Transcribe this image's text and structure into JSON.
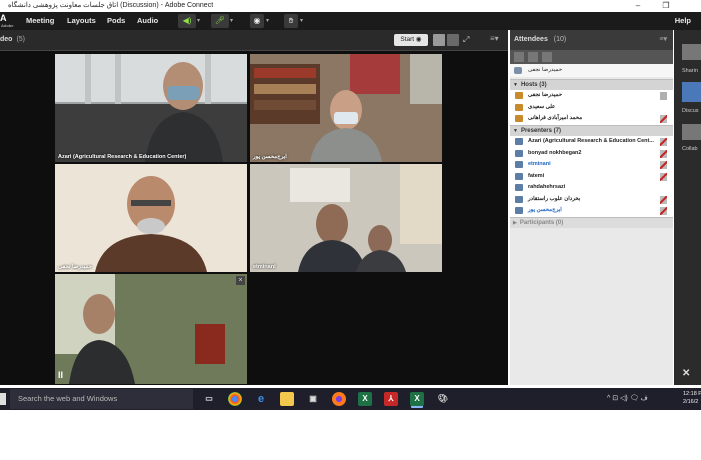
{
  "window": {
    "title": "اتاق جلسات معاونت پژوهشی دانشگاه (Discussion) - Adobe Connect",
    "minimize": "–",
    "maximize": "❐"
  },
  "menubar": {
    "logo": "A",
    "logo_sub": "Adobe",
    "items": [
      "Meeting",
      "Layouts",
      "Pods",
      "Audio"
    ],
    "help": "Help"
  },
  "video_pod": {
    "title": "deo",
    "count": "(5)",
    "start_label": "Start",
    "tiles": [
      {
        "label": "Azari (Agricultural Research & Education Center)"
      },
      {
        "label": "ایرج‌محسن پور"
      },
      {
        "label": "حمیدرضا نجفی"
      },
      {
        "label": "etminani"
      },
      {
        "label": ""
      }
    ],
    "close_glyph": "×",
    "pause_glyph": "II"
  },
  "attendees": {
    "title": "Attendees",
    "count": "(10)",
    "me": "حمیدرضا نجفی",
    "hosts_section": "Hosts (3)",
    "hosts": [
      {
        "name": "حمیدرضا نجفی",
        "blue": false
      },
      {
        "name": "علی سعیدی",
        "blue": false
      },
      {
        "name": "محمد امیرآبادی فراهانی",
        "blue": false
      }
    ],
    "presenters_section": "Presenters (7)",
    "presenters": [
      {
        "name": "Azari (Agricultural Research & Education Cent...",
        "blue": false
      },
      {
        "name": "bonyad nokhbegan2",
        "blue": false
      },
      {
        "name": "etminani",
        "blue": true
      },
      {
        "name": "fatemi",
        "blue": false
      },
      {
        "name": "rahdahehrsazi",
        "blue": false
      },
      {
        "name": "بخردان علوب راستقادر",
        "blue": false
      },
      {
        "name": "ایرج‌محسن پور",
        "blue": true
      }
    ],
    "participants_section": "Participants (0)"
  },
  "right_strip": {
    "labels": [
      "Sharin",
      "Discus",
      "Collab"
    ],
    "close": "✕"
  },
  "taskbar": {
    "search_placeholder": "Search the web and Windows",
    "tray": "^ ⊡ ◁) 🗨  ف",
    "time": "12:18 P",
    "date": "2/16/2"
  },
  "colors": {
    "active_green": "#8fe04a",
    "name_blue": "#1f66c1",
    "mic_off_red": "#c62828"
  }
}
